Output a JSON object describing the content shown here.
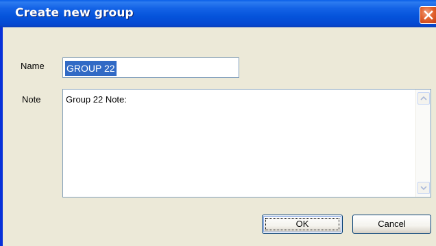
{
  "dialog": {
    "title": "Create new group",
    "name_label": "Name",
    "name_value": "GROUP 22",
    "note_label": "Note",
    "note_value": "Group 22 Note:",
    "ok_label": "OK",
    "cancel_label": "Cancel"
  },
  "icons": {
    "close": "close-icon",
    "scroll_up": "scroll-up-arrow-icon",
    "scroll_down": "scroll-down-arrow-icon"
  },
  "colors": {
    "titlebar": "#0553DB",
    "dialog_bg": "#ECE9D8",
    "selection": "#316AC5",
    "close_button": "#E2632F"
  }
}
